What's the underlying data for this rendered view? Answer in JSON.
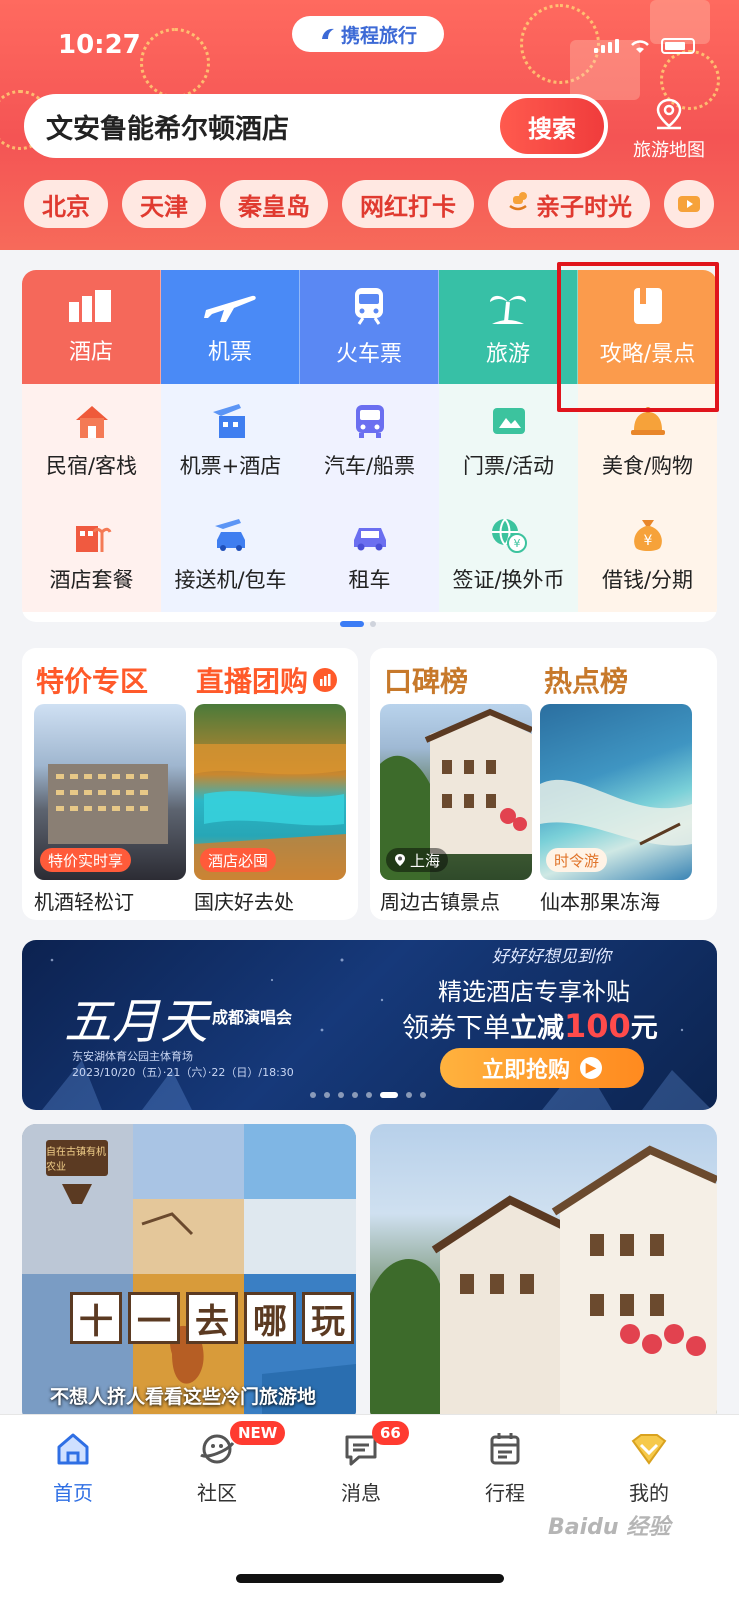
{
  "status": {
    "time": "10:27"
  },
  "brand": {
    "name": "携程旅行"
  },
  "search": {
    "value": "文安鲁能希尔顿酒店",
    "button": "搜索"
  },
  "travel_map": {
    "label": "旅游地图"
  },
  "chips": [
    {
      "label": "北京"
    },
    {
      "label": "天津"
    },
    {
      "label": "秦皇岛"
    },
    {
      "label": "网红打卡"
    },
    {
      "label": "亲子时光"
    }
  ],
  "services": {
    "top": [
      {
        "label": "酒店",
        "color": "#f5685a"
      },
      {
        "label": "机票",
        "color": "#4a8af6"
      },
      {
        "label": "火车票",
        "color": "#5a88f3"
      },
      {
        "label": "旅游",
        "color": "#37c0a6"
      },
      {
        "label": "攻略/景点",
        "color": "#fb9b4c"
      }
    ],
    "row2": [
      {
        "label": "民宿/客栈"
      },
      {
        "label": "机票+酒店"
      },
      {
        "label": "汽车/船票"
      },
      {
        "label": "门票/活动"
      },
      {
        "label": "美食/购物"
      }
    ],
    "row3": [
      {
        "label": "酒店套餐"
      },
      {
        "label": "接送机/包车"
      },
      {
        "label": "租车"
      },
      {
        "label": "签证/换外币"
      },
      {
        "label": "借钱/分期"
      }
    ]
  },
  "promo_left": {
    "title1": "特价专区",
    "title2": "直播团购",
    "items": [
      {
        "tag": "特价实时享",
        "caption": "机酒轻松订"
      },
      {
        "tag": "酒店必囤",
        "caption": "国庆好去处"
      }
    ]
  },
  "promo_right": {
    "title1": "口碑榜",
    "title2": "热点榜",
    "items": [
      {
        "tag": "上海",
        "caption": "周边古镇景点"
      },
      {
        "tag": "时令游",
        "caption": "仙本那果冻海"
      }
    ]
  },
  "banner": {
    "logo": "五月天",
    "event": "成都演唱会",
    "sub1": "东安湖体育公园主体育场",
    "sub2": "2023/10/20（五）·21（六）·22（日）/18:30",
    "script": "好好好想见到你",
    "line1": "精选酒店专享补贴",
    "line2_a": "领券下单",
    "line2_b": "立减",
    "line2_c": "100",
    "line2_d": "元",
    "button": "立即抢购"
  },
  "feed": {
    "left_title_chars": [
      "十",
      "一",
      "去",
      "哪",
      "玩"
    ],
    "left_sign": "自在古镇有机农业",
    "left_caption": "不想人挤人看看这些冷门旅游地"
  },
  "tabs": [
    {
      "label": "首页",
      "active": true
    },
    {
      "label": "社区",
      "badge": "NEW"
    },
    {
      "label": "消息",
      "badge": "66"
    },
    {
      "label": "行程"
    },
    {
      "label": "我的"
    }
  ],
  "watermark": "Baidu 经验"
}
